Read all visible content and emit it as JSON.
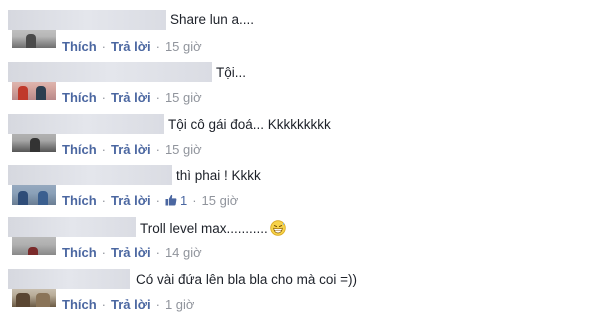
{
  "comments": [
    {
      "text": "Share lun a....",
      "time": "15 giờ",
      "likes": ""
    },
    {
      "text": "Tội...",
      "time": "15 giờ",
      "likes": ""
    },
    {
      "text": "Tội cô gái đoá... Kkkkkkkkk",
      "time": "15 giờ",
      "likes": ""
    },
    {
      "text": "thì phai ! Kkkk",
      "time": "15 giờ",
      "likes": "1"
    },
    {
      "text": "Troll level max...........",
      "time": "14 giờ",
      "likes": ""
    },
    {
      "text": "Có vài đứa lên bla bla cho mà coi =))",
      "time": "1 giờ",
      "likes": ""
    }
  ],
  "actions": {
    "like": "Thích",
    "reply": "Trả lời",
    "separator": "·"
  },
  "colors": {
    "link": "#4b67a1",
    "meta": "#90949c",
    "text": "#1d2129"
  },
  "icons": {
    "like": "thumbs-up-icon",
    "emoji": "grinning-sweat-emoji-icon"
  }
}
